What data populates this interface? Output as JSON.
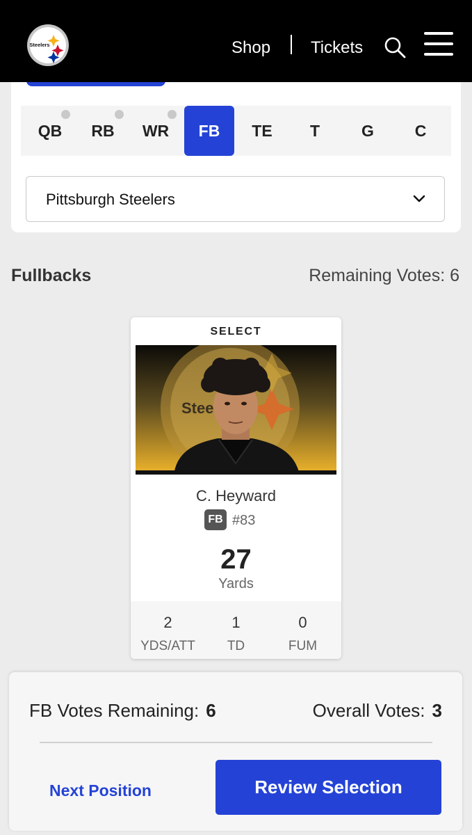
{
  "header": {
    "logo_text": "Steelers",
    "nav": {
      "shop_label": "Shop",
      "tickets_label": "Tickets"
    },
    "icons": [
      "search-icon",
      "menu-icon"
    ]
  },
  "positions": {
    "tabs": [
      {
        "label": "QB",
        "has_vote_dot": true
      },
      {
        "label": "RB",
        "has_vote_dot": true
      },
      {
        "label": "WR",
        "has_vote_dot": true
      },
      {
        "label": "FB",
        "active": true
      },
      {
        "label": "TE"
      },
      {
        "label": "T"
      },
      {
        "label": "G"
      },
      {
        "label": "C"
      }
    ],
    "accent_color": "#2443d6"
  },
  "team_select": {
    "value": "Pittsburgh Steelers"
  },
  "section": {
    "title": "Fullbacks",
    "remaining_votes_label": "Remaining Votes:",
    "remaining_votes_value": "6"
  },
  "player_card": {
    "select_label": "SELECT",
    "photo_logo_text": "Steelers",
    "name": "C. Heyward",
    "position": "FB",
    "jersey": "#83",
    "main_stat_value": "27",
    "main_stat_label": "Yards",
    "stats": [
      {
        "value": "2",
        "label": "YDS/ATT"
      },
      {
        "value": "1",
        "label": "TD"
      },
      {
        "value": "0",
        "label": "FUM"
      }
    ]
  },
  "footer": {
    "fb_votes_label": "FB Votes Remaining:",
    "fb_votes_value": "6",
    "overall_votes_label": "Overall Votes:",
    "overall_votes_value": "3",
    "next_position_label": "Next Position",
    "review_selection_label": "Review Selection"
  }
}
